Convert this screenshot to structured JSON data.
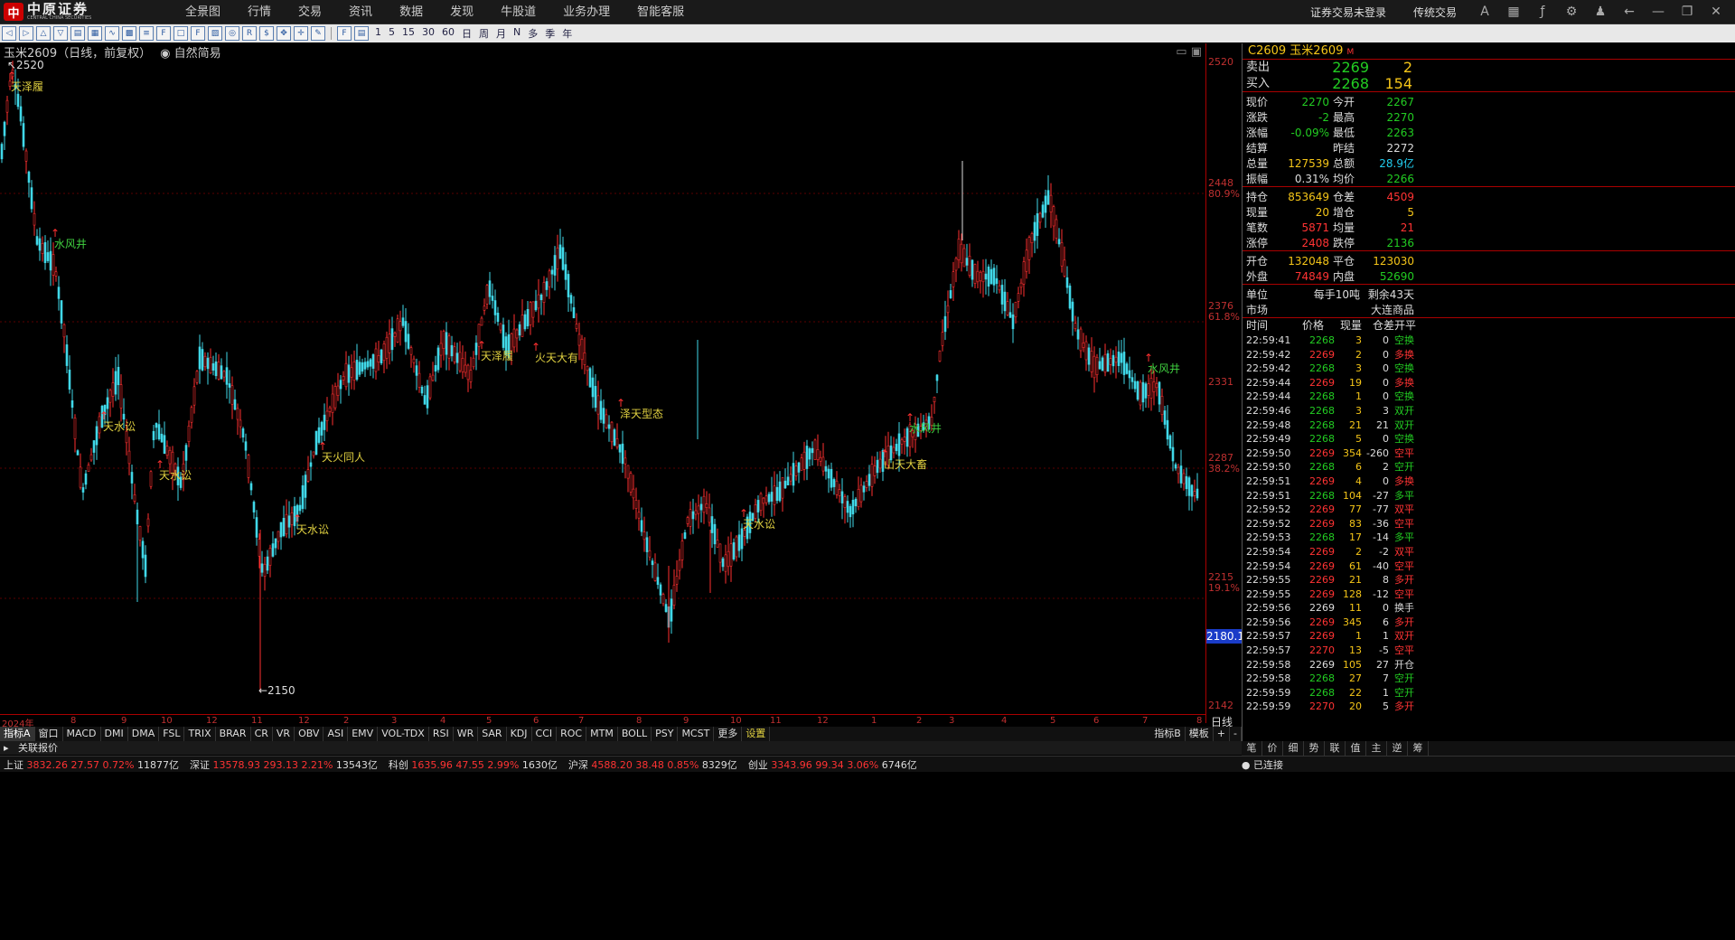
{
  "brand": {
    "name_cn": "中原证券",
    "name_en": "CENTRAL CHINA SECURITIES"
  },
  "menu": [
    "全景图",
    "行情",
    "交易",
    "资讯",
    "数据",
    "发现",
    "牛股道",
    "业务办理",
    "智能客服"
  ],
  "top_right": {
    "login": "证券交易未登录",
    "mode": "传统交易"
  },
  "toolbar": {
    "periods": [
      "1",
      "5",
      "15",
      "30",
      "60",
      "日",
      "周",
      "月",
      "N",
      "多",
      "季",
      "年"
    ]
  },
  "chart": {
    "symbol_title": "玉米2609（日线，前复权）",
    "strategy": "自然简易",
    "high_label": "2520",
    "low_label": "2150",
    "y_labels": [
      "2520",
      "2448",
      "80.9%",
      "2376",
      "61.8%",
      "2331",
      "2287",
      "38.2%",
      "2215",
      "19.1%",
      "2142"
    ],
    "current_price_tag": "2180.1",
    "x_labels": [
      "2024年",
      "8",
      "9",
      "10",
      "12",
      "11",
      "12",
      "2",
      "3",
      "4",
      "5",
      "6",
      "7",
      "8",
      "9",
      "10",
      "11",
      "12",
      "1",
      "2",
      "3",
      "4",
      "5",
      "6",
      "7",
      "8"
    ],
    "signals": [
      {
        "text": "天泽履",
        "color": "#e0d040"
      },
      {
        "text": "水风井",
        "color": "#40d040"
      },
      {
        "text": "天水讼",
        "color": "#e0d040"
      },
      {
        "text": "天水讼",
        "color": "#e0d040"
      },
      {
        "text": "天水讼",
        "color": "#e0d040"
      },
      {
        "text": "天火同人",
        "color": "#e0d040"
      },
      {
        "text": "天泽履",
        "color": "#e0d040"
      },
      {
        "text": "火天大有",
        "color": "#e0d040"
      },
      {
        "text": "泽天型态",
        "color": "#e0d040"
      },
      {
        "text": "天水讼",
        "color": "#e0d040"
      },
      {
        "text": "水风井",
        "color": "#40d040"
      },
      {
        "text": "山天大畜",
        "color": "#e0d040"
      },
      {
        "text": "水风井",
        "color": "#40d040"
      }
    ]
  },
  "indicator_tabs": [
    "指标A",
    "窗口",
    "MACD",
    "DMI",
    "DMA",
    "FSL",
    "TRIX",
    "BRAR",
    "CR",
    "VR",
    "OBV",
    "ASI",
    "EMV",
    "VOL-TDX",
    "RSI",
    "WR",
    "SAR",
    "KDJ",
    "CCI",
    "ROC",
    "MTM",
    "BOLL",
    "PSY",
    "MCST",
    "更多",
    "设置"
  ],
  "indicator_right": [
    "指标B",
    "模板",
    "+",
    "-"
  ],
  "related_quote": "关联报价",
  "quote": {
    "title": "C2609 玉米2609",
    "title_tag": "M",
    "ask_label": "卖出",
    "ask_price": "2269",
    "ask_vol": "2",
    "bid_label": "买入",
    "bid_price": "2268",
    "bid_vol": "154",
    "rows1": [
      {
        "l1": "现价",
        "v1": "2270",
        "c1": "#2c2",
        "l2": "今开",
        "v2": "2267",
        "c2": "#2c2"
      },
      {
        "l1": "涨跌",
        "v1": "-2",
        "c1": "#2c2",
        "l2": "最高",
        "v2": "2270",
        "c2": "#2c2"
      },
      {
        "l1": "涨幅",
        "v1": "-0.09%",
        "c1": "#2c2",
        "l2": "最低",
        "v2": "2263",
        "c2": "#2c2"
      },
      {
        "l1": "结算",
        "v1": "",
        "c1": "#ddd",
        "l2": "昨结",
        "v2": "2272",
        "c2": "#ddd"
      },
      {
        "l1": "总量",
        "v1": "127539",
        "c1": "#f5c518",
        "l2": "总额",
        "v2": "28.9亿",
        "c2": "#2ce"
      },
      {
        "l1": "振幅",
        "v1": "0.31%",
        "c1": "#ddd",
        "l2": "均价",
        "v2": "2266",
        "c2": "#2c2"
      }
    ],
    "rows2": [
      {
        "l1": "持仓",
        "v1": "853649",
        "c1": "#f5c518",
        "l2": "仓差",
        "v2": "4509",
        "c2": "#f33"
      },
      {
        "l1": "现量",
        "v1": "20",
        "c1": "#f5c518",
        "l2": "增仓",
        "v2": "5",
        "c2": "#f5c518"
      },
      {
        "l1": "笔数",
        "v1": "5871",
        "c1": "#f33",
        "l2": "均量",
        "v2": "21",
        "c2": "#f33"
      },
      {
        "l1": "涨停",
        "v1": "2408",
        "c1": "#f33",
        "l2": "跌停",
        "v2": "2136",
        "c2": "#2c2"
      }
    ],
    "rows3": [
      {
        "l1": "开仓",
        "v1": "132048",
        "c1": "#f5c518",
        "l2": "平仓",
        "v2": "123030",
        "c2": "#f5c518"
      },
      {
        "l1": "外盘",
        "v1": "74849",
        "c1": "#f33",
        "l2": "内盘",
        "v2": "52690",
        "c2": "#2c2"
      }
    ],
    "unit_label": "单位",
    "unit_value": "每手10吨",
    "remain": "剩余43天",
    "market_label": "市场",
    "market_value": "大连商品"
  },
  "ticks_header": [
    "时间",
    "价格",
    "现量",
    "仓差",
    "开平"
  ],
  "ticks": [
    [
      "22:59:41",
      "2268",
      "3",
      "0",
      "空换",
      "#2c2"
    ],
    [
      "22:59:42",
      "2269",
      "2",
      "0",
      "多换",
      "#f33"
    ],
    [
      "22:59:42",
      "2268",
      "3",
      "0",
      "空换",
      "#2c2"
    ],
    [
      "22:59:44",
      "2269",
      "19",
      "0",
      "多换",
      "#f33"
    ],
    [
      "22:59:44",
      "2268",
      "1",
      "0",
      "空换",
      "#2c2"
    ],
    [
      "22:59:46",
      "2268",
      "3",
      "3",
      "双开",
      "#2c2"
    ],
    [
      "22:59:48",
      "2268",
      "21",
      "21",
      "双开",
      "#2c2"
    ],
    [
      "22:59:49",
      "2268",
      "5",
      "0",
      "空换",
      "#2c2"
    ],
    [
      "22:59:50",
      "2269",
      "354",
      "-260",
      "空平",
      "#f33"
    ],
    [
      "22:59:50",
      "2268",
      "6",
      "2",
      "空开",
      "#2c2"
    ],
    [
      "22:59:51",
      "2269",
      "4",
      "0",
      "多换",
      "#f33"
    ],
    [
      "22:59:51",
      "2268",
      "104",
      "-27",
      "多平",
      "#2c2"
    ],
    [
      "22:59:52",
      "2269",
      "77",
      "-77",
      "双平",
      "#f33"
    ],
    [
      "22:59:52",
      "2269",
      "83",
      "-36",
      "空平",
      "#f33"
    ],
    [
      "22:59:53",
      "2268",
      "17",
      "-14",
      "多平",
      "#2c2"
    ],
    [
      "22:59:54",
      "2269",
      "2",
      "-2",
      "双平",
      "#f33"
    ],
    [
      "22:59:54",
      "2269",
      "61",
      "-40",
      "空平",
      "#f33"
    ],
    [
      "22:59:55",
      "2269",
      "21",
      "8",
      "多开",
      "#f33"
    ],
    [
      "22:59:55",
      "2269",
      "128",
      "-12",
      "空平",
      "#f33"
    ],
    [
      "22:59:56",
      "2269",
      "11",
      "0",
      "换手",
      "#ddd"
    ],
    [
      "22:59:56",
      "2269",
      "345",
      "6",
      "多开",
      "#f33"
    ],
    [
      "22:59:57",
      "2269",
      "1",
      "1",
      "双开",
      "#f33"
    ],
    [
      "22:59:57",
      "2270",
      "13",
      "-5",
      "空平",
      "#f33"
    ],
    [
      "22:59:58",
      "2269",
      "105",
      "27",
      "开仓",
      "#ddd"
    ],
    [
      "22:59:58",
      "2268",
      "27",
      "7",
      "空开",
      "#2c2"
    ],
    [
      "22:59:59",
      "2268",
      "22",
      "1",
      "空开",
      "#2c2"
    ],
    [
      "22:59:59",
      "2270",
      "20",
      "5",
      "多开",
      "#f33"
    ]
  ],
  "right_tabs": [
    "笔",
    "价",
    "细",
    "势",
    "联",
    "值",
    "主",
    "逆",
    "筹"
  ],
  "status": [
    {
      "name": "上证",
      "price": "3832.26",
      "chg": "27.57",
      "pct": "0.72%",
      "amt": "11877亿",
      "up": true
    },
    {
      "name": "深证",
      "price": "13578.93",
      "chg": "293.13",
      "pct": "2.21%",
      "amt": "13543亿",
      "up": true
    },
    {
      "name": "科创",
      "price": "1635.96",
      "chg": "47.55",
      "pct": "2.99%",
      "amt": "1630亿",
      "up": true
    },
    {
      "name": "沪深",
      "price": "4588.20",
      "chg": "38.48",
      "pct": "0.85%",
      "amt": "8329亿",
      "up": true
    },
    {
      "name": "创业",
      "price": "3343.96",
      "chg": "99.34",
      "pct": "3.06%",
      "amt": "6746亿",
      "up": true
    }
  ],
  "connection": "已连接"
}
